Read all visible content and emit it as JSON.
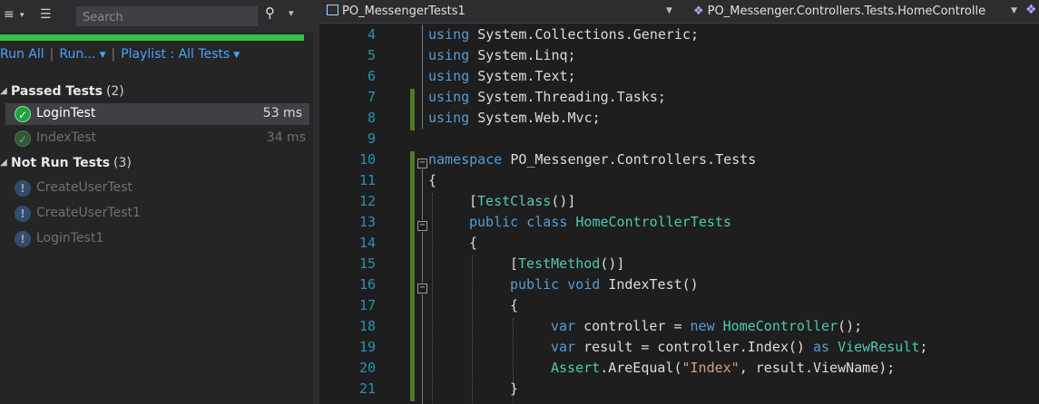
{
  "explorer": {
    "search_placeholder": "Search",
    "progress": 1.0,
    "progress_color": "#34c04a",
    "commands": {
      "run_all": "Run All",
      "run": "Run...",
      "playlist": "Playlist : All Tests"
    },
    "passed_group": {
      "label": "Passed Tests",
      "count": "(2)"
    },
    "passed_tests": [
      {
        "name": "LoginTest",
        "time": "53 ms",
        "status": "passed",
        "selected": true
      },
      {
        "name": "IndexTest",
        "time": "34 ms",
        "status": "passed",
        "selected": false
      }
    ],
    "notrun_group": {
      "label": "Not Run Tests",
      "count": "(3)"
    },
    "notrun_tests": [
      {
        "name": "CreateUserTest",
        "status": "not-run"
      },
      {
        "name": "CreateUserTest1",
        "status": "not-run"
      },
      {
        "name": "LoginTest1",
        "status": "not-run"
      }
    ]
  },
  "editor": {
    "nav_project": "PO_MessengerTests1",
    "nav_class": "PO_Messenger.Controllers.Tests.HomeControlle",
    "lines": [
      {
        "n": "4",
        "tokens": [
          [
            "kw",
            "using"
          ],
          [
            "",
            "System.Collections.Generic;"
          ]
        ]
      },
      {
        "n": "5",
        "tokens": [
          [
            "kw",
            "using"
          ],
          [
            "",
            "System.Linq;"
          ]
        ]
      },
      {
        "n": "6",
        "tokens": [
          [
            "kw",
            "using"
          ],
          [
            "",
            "System.Text;"
          ]
        ]
      },
      {
        "n": "7",
        "tokens": [
          [
            "kw",
            "using"
          ],
          [
            "",
            "System.Threading.Tasks;"
          ]
        ]
      },
      {
        "n": "8",
        "tokens": [
          [
            "kw",
            "using"
          ],
          [
            "",
            "System.Web.Mvc;"
          ]
        ]
      },
      {
        "n": "9",
        "tokens": []
      },
      {
        "n": "10",
        "tokens": [
          [
            "kw",
            "namespace"
          ],
          [
            "",
            "PO_Messenger.Controllers.Tests"
          ]
        ]
      },
      {
        "n": "11",
        "tokens": [
          [
            "",
            "{"
          ]
        ]
      },
      {
        "n": "12",
        "tokens": [
          [
            "",
            "["
          ],
          [
            "ty",
            "TestClass"
          ],
          [
            "",
            "()]"
          ]
        ]
      },
      {
        "n": "13",
        "tokens": [
          [
            "kw",
            "public"
          ],
          [
            "kw",
            "class"
          ],
          [
            "ty",
            "HomeControllerTests"
          ]
        ]
      },
      {
        "n": "14",
        "tokens": [
          [
            "",
            "{"
          ]
        ]
      },
      {
        "n": "15",
        "tokens": [
          [
            "",
            "["
          ],
          [
            "ty",
            "TestMethod"
          ],
          [
            "",
            "()]"
          ]
        ]
      },
      {
        "n": "16",
        "tokens": [
          [
            "kw",
            "public"
          ],
          [
            "kw",
            "void"
          ],
          [
            "",
            "IndexTest()"
          ]
        ]
      },
      {
        "n": "17",
        "tokens": [
          [
            "",
            "{"
          ]
        ]
      },
      {
        "n": "18",
        "tokens": [
          [
            "kw",
            "var"
          ],
          [
            "",
            "controller = "
          ],
          [
            "kw",
            "new"
          ],
          [
            "ty",
            "HomeController"
          ],
          [
            "",
            "();"
          ]
        ]
      },
      {
        "n": "19",
        "tokens": [
          [
            "kw",
            "var"
          ],
          [
            "",
            "result = controller.Index() "
          ],
          [
            "kw",
            "as"
          ],
          [
            "ty",
            "ViewResult"
          ],
          [
            "",
            ";"
          ]
        ]
      },
      {
        "n": "20",
        "tokens": [
          [
            "ty",
            "Assert"
          ],
          [
            "",
            ".AreEqual("
          ],
          [
            "st",
            "\"Index\""
          ],
          [
            "",
            ", result.ViewName);"
          ]
        ]
      },
      {
        "n": "21",
        "tokens": [
          [
            "",
            "}"
          ]
        ]
      }
    ]
  }
}
